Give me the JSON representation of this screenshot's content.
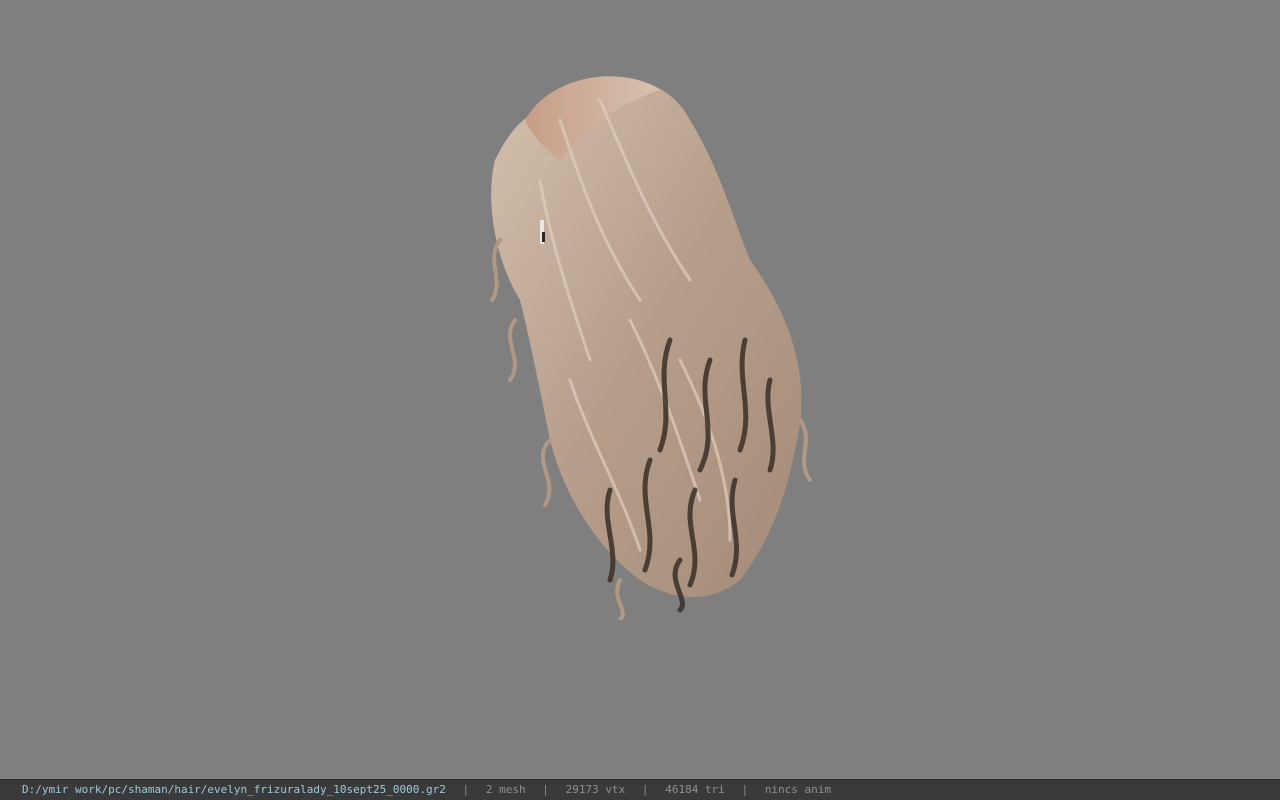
{
  "status": {
    "file_path": "D:/ymir work/pc/shaman/hair/evelyn_frizuralady_10sept25_0000.gr2",
    "separator": "|",
    "mesh": "2 mesh",
    "vertices": "29173 vtx",
    "triangles": "46184 tri",
    "anim": "nincs anim"
  },
  "colors": {
    "viewport_bg": "#7f7f7f",
    "statusbar_bg": "#3a3a3a",
    "path_text": "#9ec9d6",
    "stat_text": "#8f8f8f",
    "hair_light": "#c9b29f",
    "hair_dark": "#3a3028"
  }
}
